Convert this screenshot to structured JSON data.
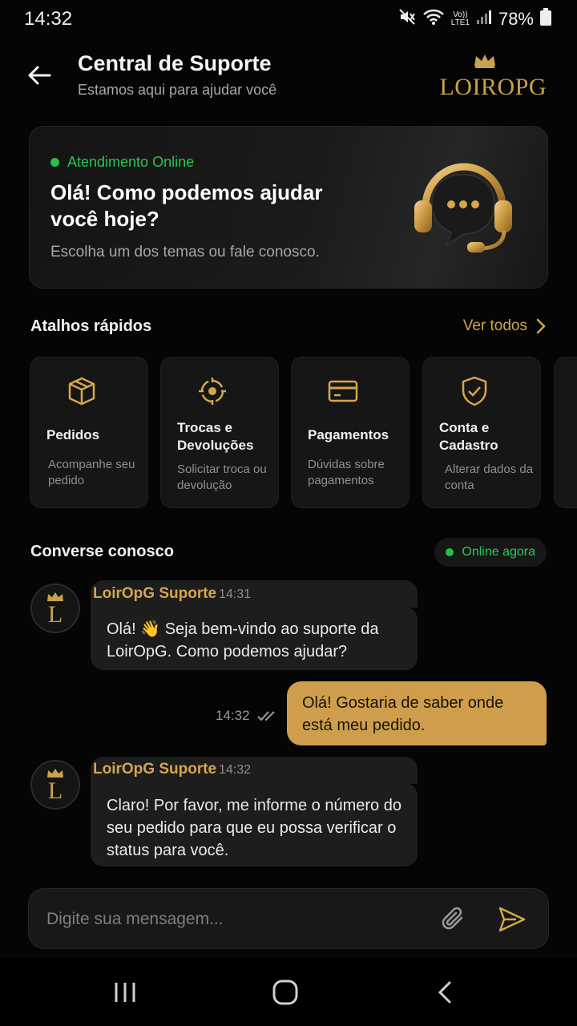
{
  "status_bar": {
    "time": "14:32",
    "battery": "78%",
    "network_top": "Vo))",
    "network_bottom": "LTE1"
  },
  "header": {
    "title": "Central de Suporte",
    "subtitle": "Estamos aqui para ajudar você",
    "logo_text": "LOIROPG"
  },
  "hero": {
    "status": "Atendimento Online",
    "title": "Olá! Como podemos ajudar você hoje?",
    "subtitle": "Escolha um dos temas ou fale conosco.",
    "icon": "headset-chat-icon"
  },
  "shortcuts": {
    "title": "Atalhos rápidos",
    "see_all": "Ver todos",
    "items": [
      {
        "icon": "box-icon",
        "title": "Pedidos",
        "desc": "Acompanhe seu pedido"
      },
      {
        "icon": "exchange-icon",
        "title": "Trocas e Devoluções",
        "desc": "Solicitar troca ou devolução"
      },
      {
        "icon": "credit-card-icon",
        "title": "Pagamentos",
        "desc": "Dúvidas sobre pagamentos"
      },
      {
        "icon": "shield-check-icon",
        "title": "Conta e Cadastro",
        "desc": "Alterar dados da conta"
      }
    ]
  },
  "chat": {
    "title": "Converse conosco",
    "status": "Online agora",
    "avatar_letter": "L",
    "messages": [
      {
        "from": "agent",
        "name": "LoirOpG Suporte",
        "time": "14:31",
        "text": "Olá! 👋 Seja bem-vindo ao suporte da LoirOpG. Como podemos ajudar?"
      },
      {
        "from": "user",
        "time": "14:32",
        "text": "Olá! Gostaria de saber onde está meu pedido."
      },
      {
        "from": "agent",
        "name": "LoirOpG Suporte",
        "time": "14:32",
        "text": "Claro! Por favor, me informe o número do seu pedido para que eu possa verificar o status para você."
      }
    ]
  },
  "input": {
    "placeholder": "Digite sua mensagem...",
    "value": ""
  },
  "colors": {
    "accent_gold": "#d4a64d",
    "online_green": "#2bc551",
    "background": "#050505"
  }
}
